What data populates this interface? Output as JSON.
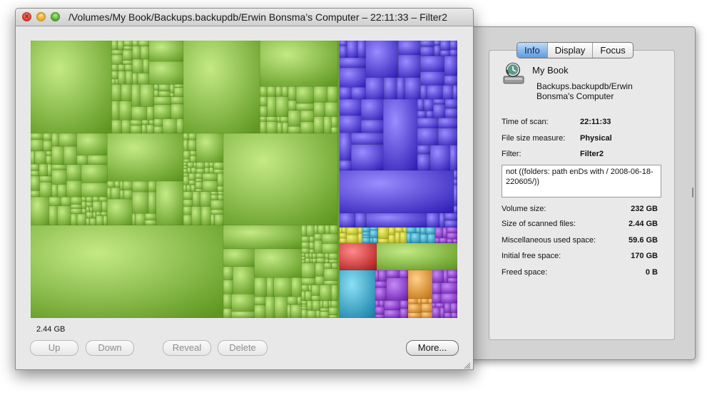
{
  "window": {
    "title": "/Volumes/My Book/Backups.backupdb/Erwin Bonsma’s Computer – 22:11:33 – Filter2"
  },
  "treemap": {
    "accent_colors": {
      "green": "#7fb63a",
      "blue": "#4a3fe0",
      "purple": "#8a38d8",
      "yellow": "#d9d92a",
      "cyan": "#38b6d8",
      "red": "#e23a3a",
      "orange": "#f0a030"
    }
  },
  "status": {
    "selected_size": "2.44 GB"
  },
  "buttons": {
    "up": "Up",
    "down": "Down",
    "reveal": "Reveal",
    "delete": "Delete",
    "more": "More..."
  },
  "drawer": {
    "tabs": [
      "Info",
      "Display",
      "Focus"
    ],
    "active_tab": "Info",
    "volume_name": "My Book",
    "volume_path": "Backups.backupdb/Erwin Bonsma's Computer",
    "fields": {
      "time_of_scan_label": "Time of scan:",
      "time_of_scan": "22:11:33",
      "file_size_measure_label": "File size measure:",
      "file_size_measure": "Physical",
      "filter_label": "Filter:",
      "filter": "Filter2",
      "filter_description": "not ((folders: path enDs with / 2008-06-18-220605/))"
    },
    "stats": [
      {
        "label": "Volume size:",
        "value": "232 GB"
      },
      {
        "label": "Size of scanned files:",
        "value": "2.44 GB"
      },
      {
        "label": "Miscellaneous used space:",
        "value": "59.6 GB"
      },
      {
        "label": "Initial free space:",
        "value": "170 GB"
      },
      {
        "label": "Freed space:",
        "value": "0 B"
      }
    ]
  }
}
